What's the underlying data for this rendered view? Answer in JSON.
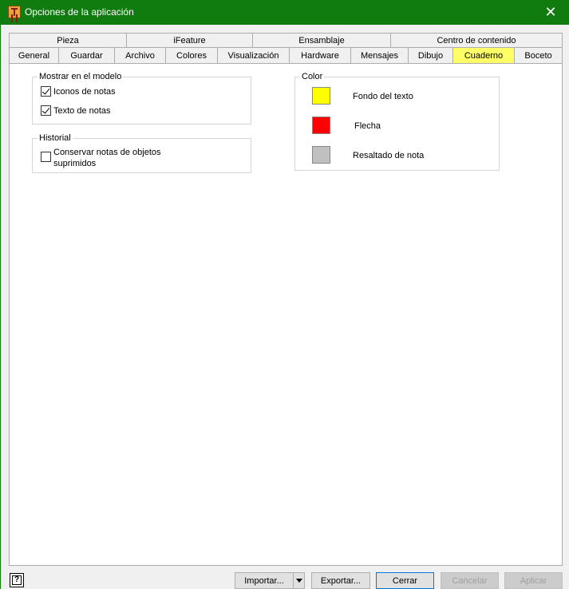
{
  "window": {
    "title": "Opciones de la aplicación",
    "close_symbol": "✕"
  },
  "tabs": {
    "row1": [
      "Pieza",
      "iFeature",
      "Ensamblaje",
      "Centro de contenido"
    ],
    "row2": [
      "General",
      "Guardar",
      "Archivo",
      "Colores",
      "Visualización",
      "Hardware",
      "Mensajes",
      "Dibujo",
      "Cuaderno",
      "Boceto"
    ],
    "active": "Cuaderno",
    "active_color": "#ffff66"
  },
  "mostrar": {
    "legend": "Mostrar en el modelo",
    "items": [
      {
        "label": "Iconos de notas",
        "checked": true
      },
      {
        "label": "Texto de notas",
        "checked": true
      }
    ]
  },
  "historial": {
    "legend": "Historial",
    "items": [
      {
        "label_line1": "Conservar notas de objetos",
        "label_line2": "suprimidos",
        "checked": false
      }
    ]
  },
  "color": {
    "legend": "Color",
    "items": [
      {
        "label": "Fondo del texto",
        "swatch": "#ffff00"
      },
      {
        "label": "Flecha",
        "swatch": "#ff0000"
      },
      {
        "label": "Resaltado de nota",
        "swatch": "#c0c0c0"
      }
    ]
  },
  "buttons": {
    "help": "?",
    "importar": "Importar...",
    "exportar": "Exportar...",
    "cerrar": "Cerrar",
    "cancelar": "Cancelar",
    "aplicar": "Aplicar"
  }
}
